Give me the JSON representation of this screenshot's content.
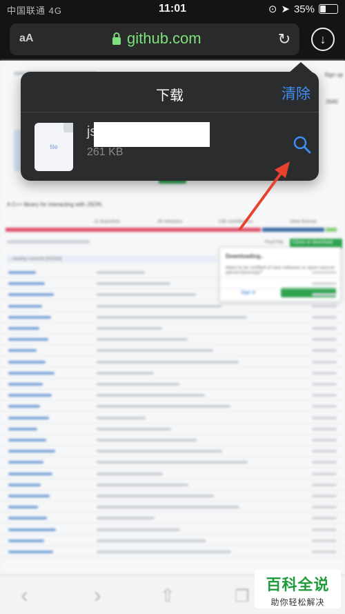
{
  "status_bar": {
    "carrier": "中国联通 4G",
    "time": "11:01",
    "battery": "35%",
    "battery_level": 0.35
  },
  "browser": {
    "text_size_label": "aA",
    "url": "github.com",
    "reload_icon": "reload-icon",
    "downloads_icon": "download-icon"
  },
  "downloads_popover": {
    "title": "下载",
    "clear_label": "清除",
    "file": {
      "name_prefix": "js",
      "size": "261 KB",
      "type_label": "file"
    }
  },
  "background_page": {
    "description_fragment": "A C++ library for interacting with JSON.",
    "stats": {
      "branches": "11 branches",
      "releases": "49 releases",
      "contributors": "138 contributors",
      "license": "View license"
    },
    "find_file": "Find File",
    "clone_button": "Clone or download",
    "downloading_title": "Downloading..",
    "downloading_text": "Want to be notified of new releases in open-source-parsers/jsoncpp?",
    "sign_in": "Sign in",
    "sign_up": "Sign up",
    "commits_fragment": "...nearby commit (#1033)",
    "count_fragment": "2640"
  },
  "toolbar": {
    "back_icon": "back-arrow-icon",
    "forward_icon": "forward-arrow-icon",
    "share_icon": "share-icon",
    "tabs_icon": "tabs-icon"
  },
  "watermark": {
    "line1": "百科全说",
    "line2": "助你轻松解决"
  },
  "colors": {
    "accent_blue": "#3e8ef7",
    "url_green": "#7de07d",
    "arrow_red": "#e8412e",
    "watermark_green": "#1f9b3a"
  }
}
